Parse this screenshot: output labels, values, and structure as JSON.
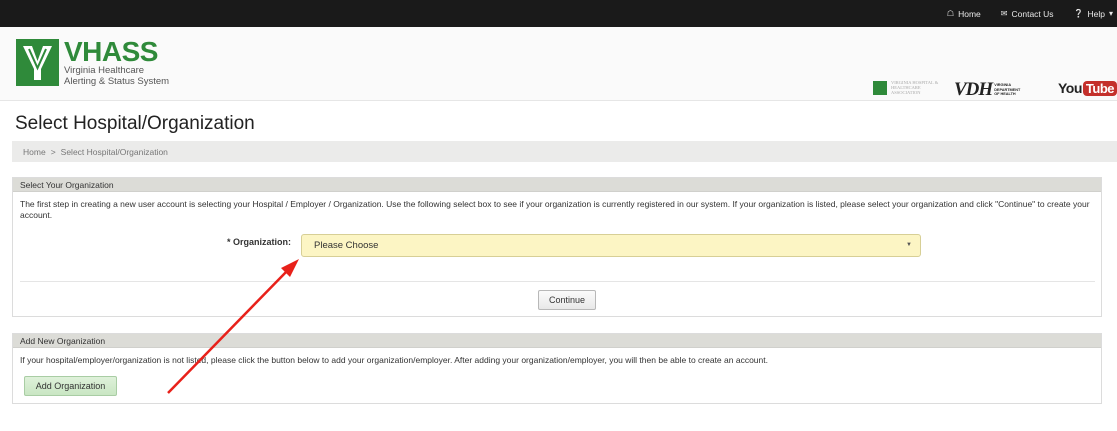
{
  "topnav": {
    "home": "Home",
    "contact": "Contact Us",
    "help": "Help"
  },
  "logo": {
    "title": "VHASS",
    "line1": "Virginia Healthcare",
    "line2": "Alerting & Status System"
  },
  "partners": {
    "vhha": "VIRGINIA HOSPITAL & HEALTHCARE ASSOCIATION",
    "vdh": "VDH",
    "vdh_sub": "VIRGINIA DEPARTMENT OF HEALTH",
    "youtube_you": "You",
    "youtube_tube": "Tube"
  },
  "page": {
    "title": "Select Hospital/Organization"
  },
  "breadcrumb": {
    "home": "Home",
    "separator": ">",
    "current": "Select Hospital/Organization"
  },
  "select_panel": {
    "heading": "Select Your Organization",
    "description": "The first step in creating a new user account is selecting your Hospital / Employer / Organization. Use the following select box to see if your organization is currently registered in our system. If your organization is listed, please select your organization and click \"Continue\" to create your account.",
    "org_label": "* Organization:",
    "org_selected": "Please Choose",
    "continue_label": "Continue"
  },
  "add_panel": {
    "heading": "Add New Organization",
    "description": "If your hospital/employer/organization is not listed, please click the button below to add your organization/employer. After adding your organization/employer, you will then be able to create an account.",
    "button_label": "Add Organization"
  },
  "colors": {
    "brand_green": "#2f8a3a",
    "topbar": "#1a1a1a",
    "select_bg": "#fcf5c4",
    "arrow": "#e8211a"
  }
}
